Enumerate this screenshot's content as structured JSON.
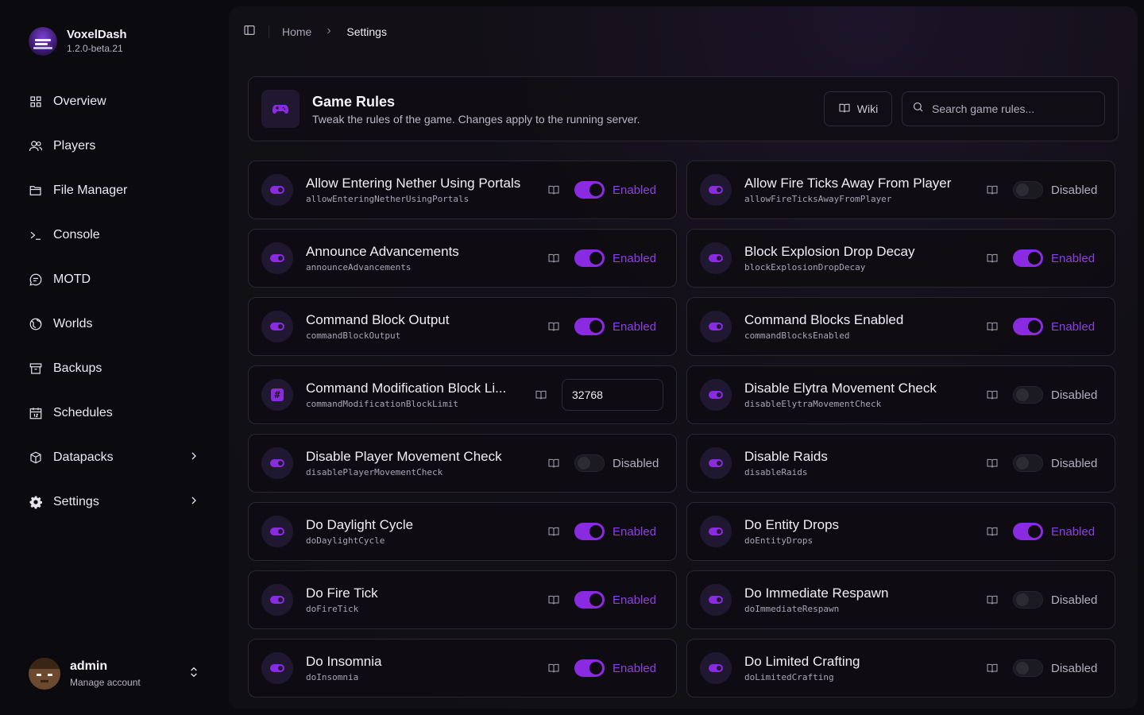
{
  "brand": {
    "name": "VoxelDash",
    "version": "1.2.0-beta.21"
  },
  "nav": [
    {
      "id": "overview",
      "label": "Overview",
      "icon": "grid-icon"
    },
    {
      "id": "players",
      "label": "Players",
      "icon": "users-icon"
    },
    {
      "id": "file-manager",
      "label": "File Manager",
      "icon": "folder-icon"
    },
    {
      "id": "console",
      "label": "Console",
      "icon": "terminal-icon"
    },
    {
      "id": "motd",
      "label": "MOTD",
      "icon": "message-icon"
    },
    {
      "id": "worlds",
      "label": "Worlds",
      "icon": "globe-icon"
    },
    {
      "id": "backups",
      "label": "Backups",
      "icon": "archive-icon"
    },
    {
      "id": "schedules",
      "label": "Schedules",
      "icon": "calendar-icon"
    },
    {
      "id": "datapacks",
      "label": "Datapacks",
      "icon": "package-icon"
    },
    {
      "id": "settings",
      "label": "Settings",
      "icon": "gear-icon"
    }
  ],
  "user": {
    "name": "admin",
    "sub": "Manage account"
  },
  "breadcrumb": {
    "home": "Home",
    "current": "Settings"
  },
  "header": {
    "title": "Game Rules",
    "subtitle": "Tweak the rules of the game. Changes apply to the running server.",
    "wiki_label": "Wiki",
    "search_placeholder": "Search game rules..."
  },
  "colors": {
    "accent": "#8a2be2",
    "background": "#0b0a0e"
  },
  "rules": [
    {
      "name": "Allow Entering Nether Using Portals",
      "key": "allowEnteringNetherUsingPortals",
      "type": "bool",
      "enabled": true,
      "state": "Enabled"
    },
    {
      "name": "Allow Fire Ticks Away From Player",
      "key": "allowFireTicksAwayFromPlayer",
      "type": "bool",
      "enabled": false,
      "state": "Disabled"
    },
    {
      "name": "Announce Advancements",
      "key": "announceAdvancements",
      "type": "bool",
      "enabled": true,
      "state": "Enabled"
    },
    {
      "name": "Block Explosion Drop Decay",
      "key": "blockExplosionDropDecay",
      "type": "bool",
      "enabled": true,
      "state": "Enabled"
    },
    {
      "name": "Command Block Output",
      "key": "commandBlockOutput",
      "type": "bool",
      "enabled": true,
      "state": "Enabled"
    },
    {
      "name": "Command Blocks Enabled",
      "key": "commandBlocksEnabled",
      "type": "bool",
      "enabled": true,
      "state": "Enabled"
    },
    {
      "name": "Command Modification Block Li...",
      "key": "commandModificationBlockLimit",
      "type": "int",
      "value": "32768"
    },
    {
      "name": "Disable Elytra Movement Check",
      "key": "disableElytraMovementCheck",
      "type": "bool",
      "enabled": false,
      "state": "Disabled"
    },
    {
      "name": "Disable Player Movement Check",
      "key": "disablePlayerMovementCheck",
      "type": "bool",
      "enabled": false,
      "state": "Disabled"
    },
    {
      "name": "Disable Raids",
      "key": "disableRaids",
      "type": "bool",
      "enabled": false,
      "state": "Disabled"
    },
    {
      "name": "Do Daylight Cycle",
      "key": "doDaylightCycle",
      "type": "bool",
      "enabled": true,
      "state": "Enabled"
    },
    {
      "name": "Do Entity Drops",
      "key": "doEntityDrops",
      "type": "bool",
      "enabled": true,
      "state": "Enabled"
    },
    {
      "name": "Do Fire Tick",
      "key": "doFireTick",
      "type": "bool",
      "enabled": true,
      "state": "Enabled"
    },
    {
      "name": "Do Immediate Respawn",
      "key": "doImmediateRespawn",
      "type": "bool",
      "enabled": false,
      "state": "Disabled"
    },
    {
      "name": "Do Insomnia",
      "key": "doInsomnia",
      "type": "bool",
      "enabled": true,
      "state": "Enabled"
    },
    {
      "name": "Do Limited Crafting",
      "key": "doLimitedCrafting",
      "type": "bool",
      "enabled": false,
      "state": "Disabled"
    }
  ]
}
